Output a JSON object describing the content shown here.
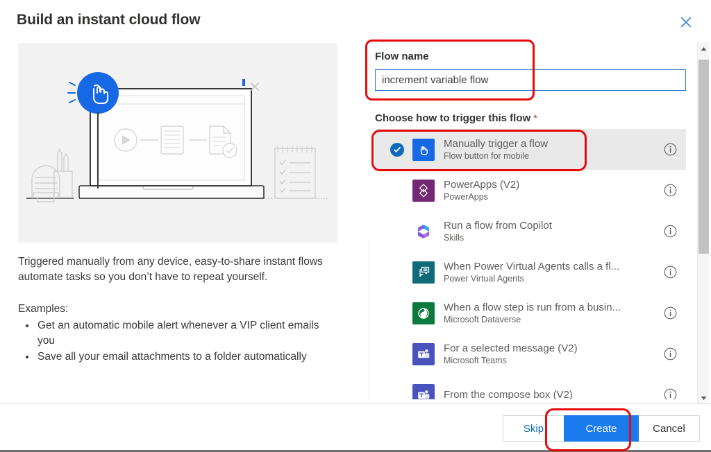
{
  "dialog": {
    "title": "Build an instant cloud flow",
    "close_icon": "close-icon"
  },
  "left": {
    "illustration_alt": "laptop-flow-illustration",
    "description": "Triggered manually from any device, easy-to-share instant flows automate tasks so you don’t have to repeat yourself.",
    "examples_label": "Examples:",
    "examples": [
      "Get an automatic mobile alert whenever a VIP client emails you",
      "Save all your email attachments to a folder automatically"
    ]
  },
  "right": {
    "flow_name_label": "Flow name",
    "flow_name_value": "increment variable flow",
    "flow_name_placeholder": "Flow name",
    "trigger_label": "Choose how to trigger this flow",
    "required_marker": "*",
    "triggers": [
      {
        "title": "Manually trigger a flow",
        "subtitle": "Flow button for mobile",
        "icon": "flow-button-icon",
        "icon_color": "#1768e5",
        "selected": true,
        "info": "info-icon"
      },
      {
        "title": "PowerApps (V2)",
        "subtitle": "PowerApps",
        "icon": "powerapps-icon",
        "icon_color": "#742774",
        "selected": false,
        "info": "info-icon"
      },
      {
        "title": "Run a flow from Copilot",
        "subtitle": "Skills",
        "icon": "copilot-icon",
        "icon_color": "#ffffff",
        "selected": false,
        "info": "info-icon"
      },
      {
        "title": "When Power Virtual Agents calls a fl...",
        "subtitle": "Power Virtual Agents",
        "icon": "power-virtual-agents-icon",
        "icon_color": "#0f6b77",
        "selected": false,
        "info": "info-icon"
      },
      {
        "title": "When a flow step is run from a busin...",
        "subtitle": "Microsoft Dataverse",
        "icon": "dataverse-icon",
        "icon_color": "#0b7a3e",
        "selected": false,
        "info": "info-icon"
      },
      {
        "title": "For a selected message (V2)",
        "subtitle": "Microsoft Teams",
        "icon": "teams-icon",
        "icon_color": "#4a52bd",
        "selected": false,
        "info": "info-icon"
      },
      {
        "title": "From the compose box (V2)",
        "subtitle": "",
        "icon": "teams-icon",
        "icon_color": "#4a52bd",
        "selected": false,
        "info": "info-icon"
      }
    ]
  },
  "scrollbar": {
    "up_arrow": "caret-up-icon",
    "down_arrow": "caret-down-icon"
  },
  "footer": {
    "skip_label": "Skip",
    "create_label": "Create",
    "cancel_label": "Cancel"
  },
  "annotations": {
    "accent_red": "#e8090b",
    "primary_blue": "#197bed"
  }
}
